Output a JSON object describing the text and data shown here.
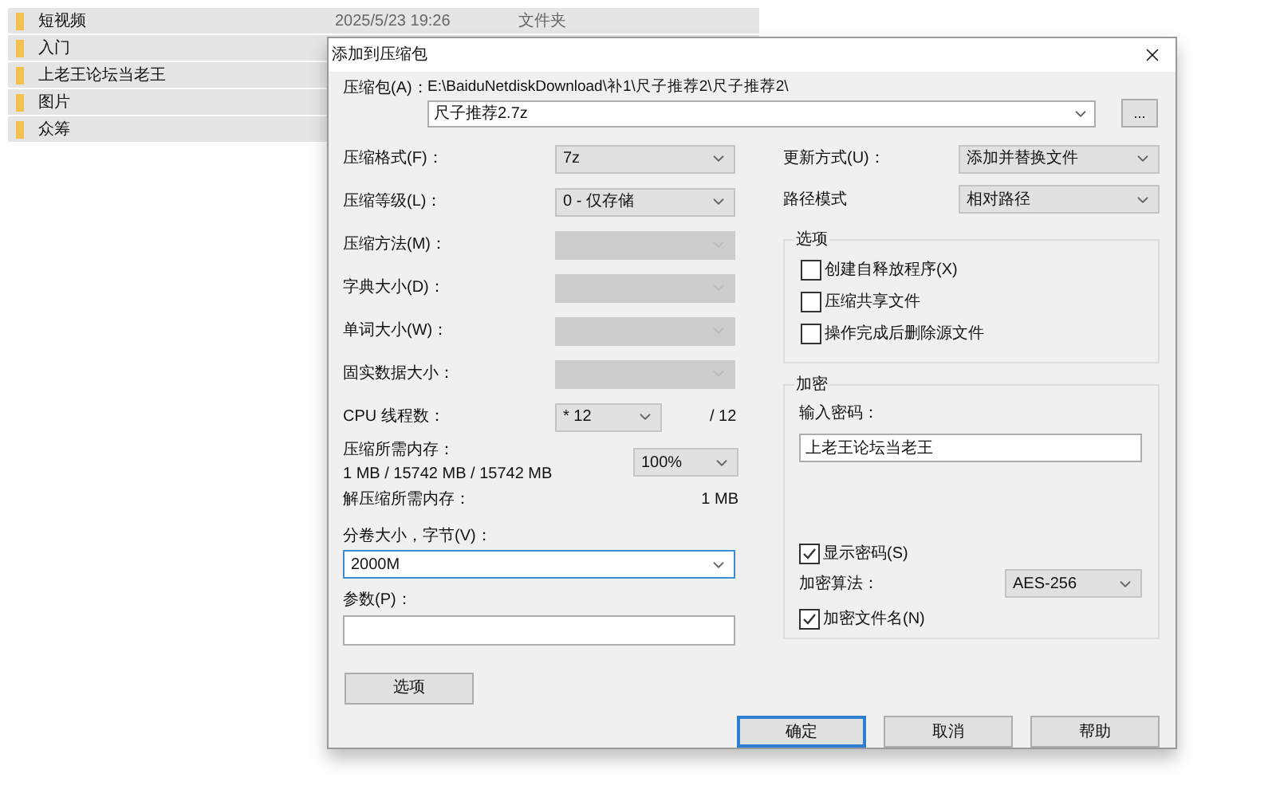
{
  "explorer": {
    "rows": [
      {
        "name": "短视频",
        "date": "2025/5/23 19:26",
        "type": "文件夹"
      },
      {
        "name": "入门"
      },
      {
        "name": "上老王论坛当老王"
      },
      {
        "name": "图片"
      },
      {
        "name": "众筹"
      }
    ]
  },
  "dialog": {
    "title": "添加到压缩包",
    "archive": {
      "label": "压缩包(A)：",
      "path": "E:\\BaiduNetdiskDownload\\补1\\尺子推荐2\\尺子推荐2\\",
      "value": "尺子推荐2.7z"
    },
    "browse_button": "...",
    "settings": [
      {
        "label": "压缩格式(F)：",
        "value": "7z",
        "disabled": false
      },
      {
        "label": "压缩等级(L)：",
        "value": "0 - 仅存储",
        "disabled": false
      },
      {
        "label": "压缩方法(M)：",
        "disabled": true
      },
      {
        "label": "字典大小(D)：",
        "disabled": true
      },
      {
        "label": "单词大小(W)：",
        "disabled": true
      },
      {
        "label": "固实数据大小：",
        "disabled": true
      }
    ],
    "cpu_threads": {
      "label": "CPU 线程数：",
      "value": "* 12",
      "total": "/ 12"
    },
    "memory": {
      "label": "压缩所需内存：",
      "detail": "1 MB / 15742 MB / 15742 MB",
      "value": "100%"
    },
    "decompress_memory": {
      "label": "解压缩所需内存：",
      "value": "1 MB"
    },
    "split": {
      "label": "分卷大小，字节(V)：",
      "value": "2000M"
    },
    "parameters": {
      "label": "参数(P)："
    },
    "options_button": "选项",
    "update_mode": {
      "label": "更新方式(U)：",
      "value": "添加并替换文件"
    },
    "path_mode": {
      "label": "路径模式",
      "value": "相对路径"
    },
    "options_group": {
      "title": "选项",
      "checkboxes": [
        {
          "label": "创建自释放程序(X)",
          "checked": false
        },
        {
          "label": "压缩共享文件",
          "checked": false
        },
        {
          "label": "操作完成后删除源文件",
          "checked": false
        }
      ]
    },
    "encryption": {
      "title": "加密",
      "password_label": "输入密码：",
      "password": "上老王论坛当老王",
      "show_password": {
        "label": "显示密码(S)",
        "checked": true
      },
      "method": {
        "label": "加密算法：",
        "value": "AES-256"
      },
      "encrypt_names": {
        "label": "加密文件名(N)",
        "checked": true
      }
    },
    "buttons": [
      "确定",
      "取消",
      "帮助"
    ]
  }
}
